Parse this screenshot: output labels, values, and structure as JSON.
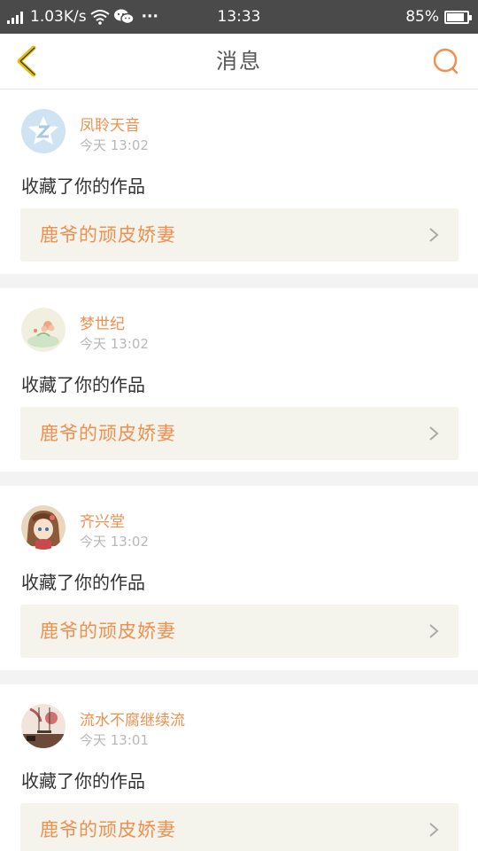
{
  "status_bar": {
    "network_speed": "1.03K/s",
    "more": "···",
    "time": "13:33",
    "battery_percent": "85%",
    "battery_level": 0.85
  },
  "header": {
    "title": "消息",
    "back_icon": "chevron-left-icon",
    "search_icon": "search-icon",
    "accent_color": "#f0904f",
    "back_color": "#e6b800"
  },
  "messages": [
    {
      "username": "凤聆天音",
      "time": "今天 13:02",
      "action": "收藏了你的作品",
      "work_title": "鹿爷的顽皮娇妻",
      "avatar": "default-avatar"
    },
    {
      "username": "梦世纪",
      "time": "今天 13:02",
      "action": "收藏了你的作品",
      "work_title": "鹿爷的顽皮娇妻",
      "avatar": "flower-avatar"
    },
    {
      "username": "齐兴堂",
      "time": "今天 13:02",
      "action": "收藏了你的作品",
      "work_title": "鹿爷的顽皮娇妻",
      "avatar": "anime-girl-avatar"
    },
    {
      "username": "流水不腐继续流",
      "time": "今天 13:01",
      "action": "收藏了你的作品",
      "work_title": "鹿爷的顽皮娇妻",
      "avatar": "swing-avatar"
    }
  ]
}
